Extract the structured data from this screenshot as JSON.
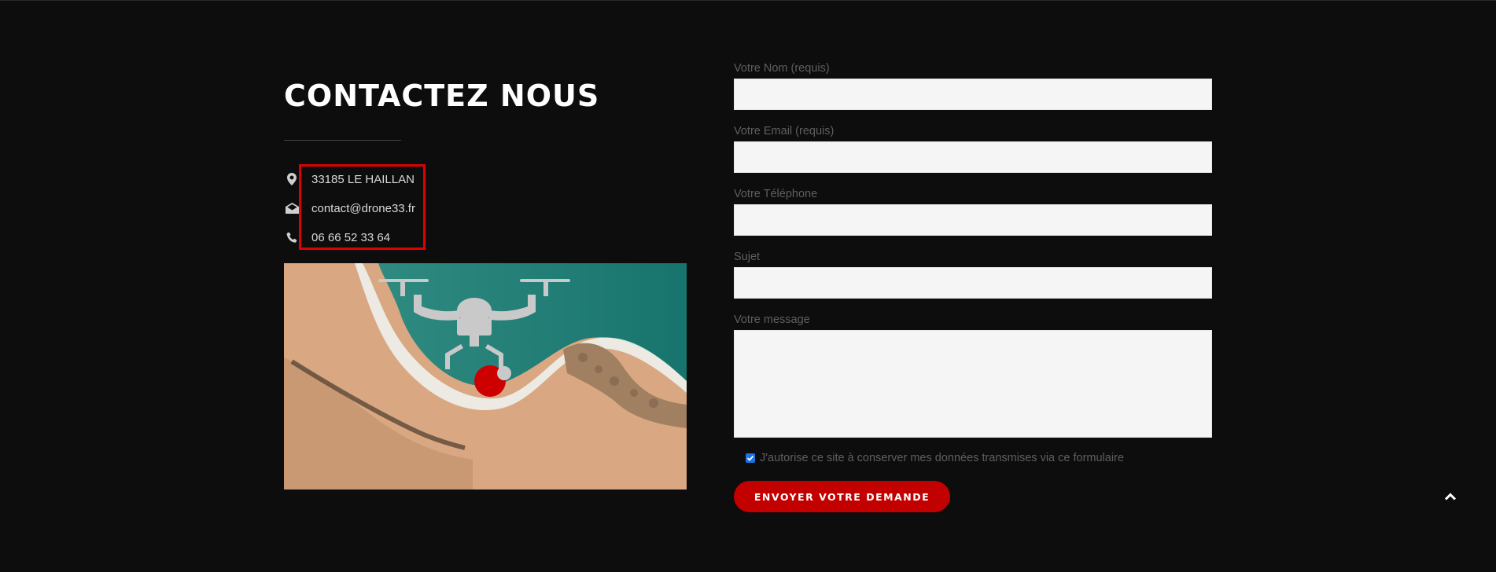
{
  "contact": {
    "title": "CONTACTEZ NOUS",
    "address": "33185 LE HAILLAN",
    "email": "contact@drone33.fr",
    "phone": "06 66 52 33 64",
    "icons": [
      "map-marker-icon",
      "envelope-open-icon",
      "phone-icon"
    ],
    "highlight_color": "#e00000"
  },
  "form": {
    "name_label": "Votre Nom (requis)",
    "email_label": "Votre Email (requis)",
    "phone_label": "Votre Téléphone",
    "subject_label": "Sujet",
    "message_label": "Votre message",
    "name_value": "",
    "email_value": "",
    "phone_value": "",
    "subject_value": "",
    "message_value": "",
    "consent_label": "J'autorise ce site à conserver mes données transmises via ce formulaire",
    "consent_checked": true,
    "submit_label": "ENVOYER VOTRE DEMANDE"
  },
  "colors": {
    "background": "#0d0d0d",
    "accent": "#c30000",
    "field_bg": "#f5f5f5"
  },
  "scroll_top_icon": "chevron-up-icon"
}
